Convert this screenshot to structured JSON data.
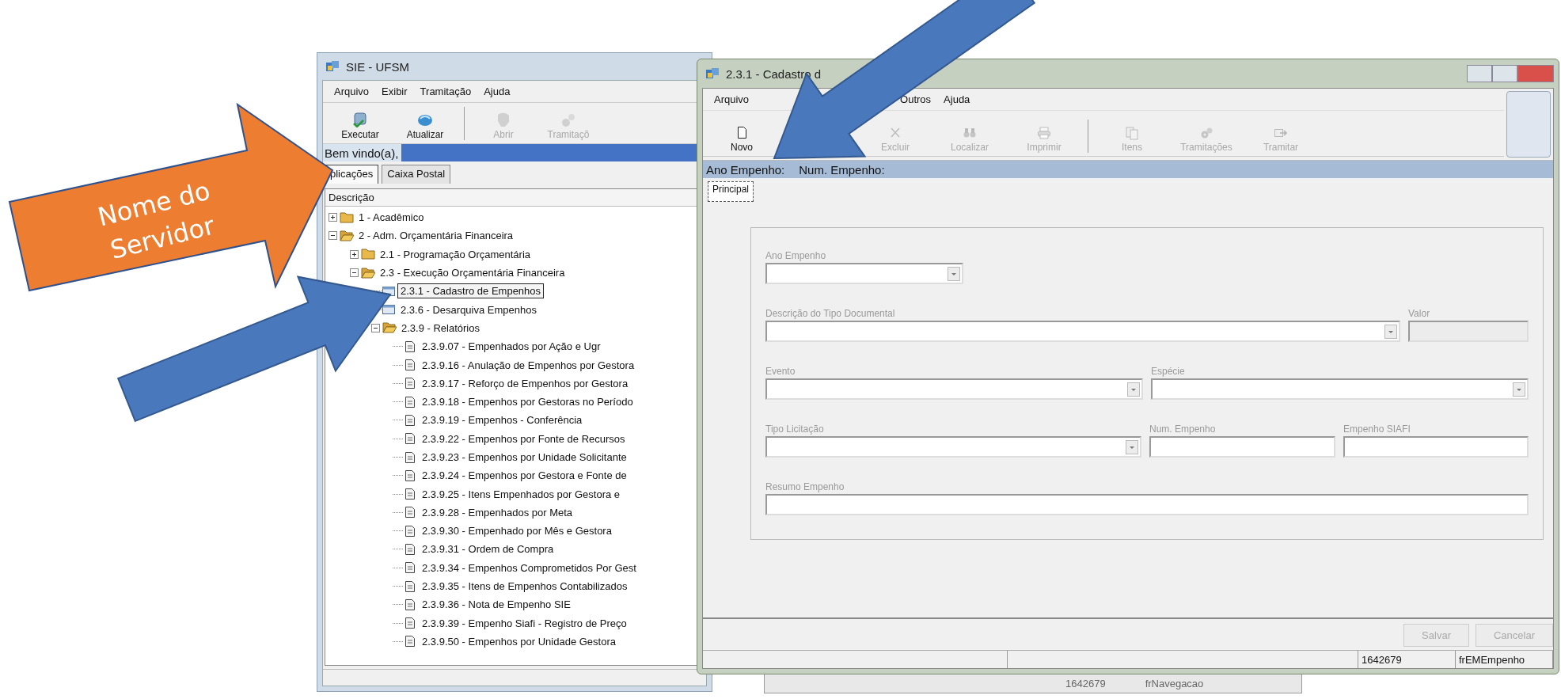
{
  "callout": {
    "lines": [
      "Nome do",
      "Servidor"
    ]
  },
  "main_window": {
    "title": "SIE - UFSM",
    "menu": [
      "Arquivo",
      "Exibir",
      "Tramitação",
      "Ajuda"
    ],
    "toolbar": [
      {
        "label": "Executar",
        "disabled": false
      },
      {
        "label": "Atualizar",
        "disabled": false
      },
      {
        "label": "Abrir",
        "disabled": true
      },
      {
        "label": "Tramitaçõ",
        "disabled": true
      }
    ],
    "welcome": "Bem vindo(a),",
    "tabs": [
      {
        "label": "plicações",
        "selected": true
      },
      {
        "label": "Caixa Postal",
        "selected": false
      }
    ],
    "tree_header": "Descrição",
    "tree": [
      {
        "label": "1 - Acadêmico",
        "kind": "folder",
        "expanded": false,
        "selected": false
      },
      {
        "label": "2 - Adm. Orçamentária Financeira",
        "kind": "folder",
        "expanded": true,
        "selected": false,
        "children": [
          {
            "label": "2.1 - Programação Orçamentária",
            "kind": "folder",
            "expanded": false,
            "selected": false
          },
          {
            "label": "2.3 - Execução Orçamentária Financeira",
            "kind": "folder",
            "expanded": true,
            "selected": false,
            "children": [
              {
                "label": "2.3.1 - Cadastro de Empenhos",
                "kind": "form",
                "selected": true
              },
              {
                "label": "2.3.6 - Desarquiva Empenhos",
                "kind": "form",
                "selected": false
              },
              {
                "label": "2.3.9 - Relatórios",
                "kind": "folder",
                "expanded": true,
                "selected": false,
                "children": [
                  {
                    "label": "2.3.9.07 - Empenhados por Ação e Ugr",
                    "kind": "report",
                    "selected": false
                  },
                  {
                    "label": "2.3.9.16 - Anulação de Empenhos por Gestora",
                    "kind": "report",
                    "selected": false
                  },
                  {
                    "label": "2.3.9.17 - Reforço de Empenhos por Gestora",
                    "kind": "report",
                    "selected": false
                  },
                  {
                    "label": "2.3.9.18 - Empenhos por Gestoras no Período",
                    "kind": "report",
                    "selected": false
                  },
                  {
                    "label": "2.3.9.19 - Empenhos - Conferência",
                    "kind": "report",
                    "selected": false
                  },
                  {
                    "label": "2.3.9.22 - Empenhos por Fonte de Recursos",
                    "kind": "report",
                    "selected": false
                  },
                  {
                    "label": "2.3.9.23 - Empenhos por Unidade Solicitante",
                    "kind": "report",
                    "selected": false
                  },
                  {
                    "label": "2.3.9.24 - Empenhos por Gestora e Fonte de",
                    "kind": "report",
                    "selected": false
                  },
                  {
                    "label": "2.3.9.25 - Itens Empenhados por Gestora e",
                    "kind": "report",
                    "selected": false
                  },
                  {
                    "label": "2.3.9.28 - Empenhados por Meta",
                    "kind": "report",
                    "selected": false
                  },
                  {
                    "label": "2.3.9.30 - Empenhado por Mês e Gestora",
                    "kind": "report",
                    "selected": false
                  },
                  {
                    "label": "2.3.9.31 - Ordem de Compra",
                    "kind": "report",
                    "selected": false
                  },
                  {
                    "label": "2.3.9.34 - Empenhos Comprometidos Por Gest",
                    "kind": "report",
                    "selected": false
                  },
                  {
                    "label": "2.3.9.35 - Itens de Empenhos Contabilizados",
                    "kind": "report",
                    "selected": false
                  },
                  {
                    "label": "2.3.9.36 - Nota de Empenho SIE",
                    "kind": "report",
                    "selected": false
                  },
                  {
                    "label": "2.3.9.39 - Empenho Siafi - Registro de Preço",
                    "kind": "report",
                    "selected": false
                  },
                  {
                    "label": "2.3.9.50 - Empenhos por Unidade Gestora",
                    "kind": "report",
                    "selected": false
                  }
                ]
              }
            ]
          }
        ]
      }
    ]
  },
  "form_window": {
    "title": "2.3.1 - Cadastro d",
    "menu": [
      "Arquivo",
      "Outros",
      "Ajuda"
    ],
    "toolbar": [
      {
        "label": "Novo",
        "disabled": false
      },
      {
        "label": "Excluir",
        "disabled": true
      },
      {
        "label": "Localizar",
        "disabled": true
      },
      {
        "label": "Imprimir",
        "disabled": true
      },
      {
        "label": "Itens",
        "disabled": true
      },
      {
        "label": "Tramitações",
        "disabled": true
      },
      {
        "label": "Tramitar",
        "disabled": true
      }
    ],
    "info": [
      "Ano Empenho:",
      "Num. Empenho:"
    ],
    "tabs": [
      {
        "label": "Principal",
        "selected": true
      }
    ],
    "field_rows": [
      [
        {
          "label": "Ano Empenho",
          "kind": "combo",
          "disabled": false
        }
      ],
      [
        {
          "label": "Descrição do Tipo Documental",
          "kind": "combo",
          "disabled": false
        },
        {
          "label": "Valor",
          "kind": "text",
          "disabled": true
        }
      ],
      [
        {
          "label": "Evento",
          "kind": "combo",
          "disabled": false
        },
        {
          "label": "Espécie",
          "kind": "combo",
          "disabled": false
        }
      ],
      [
        {
          "label": "Tipo Licitação",
          "kind": "combo",
          "disabled": false
        },
        {
          "label": "Num. Empenho",
          "kind": "text",
          "disabled": false
        },
        {
          "label": "Empenho SIAFI",
          "kind": "text",
          "disabled": false
        }
      ],
      [
        {
          "label": "Resumo Empenho",
          "kind": "text",
          "disabled": false
        }
      ]
    ],
    "buttons": [
      {
        "label": "Salvar",
        "disabled": true
      },
      {
        "label": "Cancelar",
        "disabled": true
      }
    ],
    "status": [
      "1642679",
      "frEMEmpenho"
    ]
  },
  "back_status": [
    "1642679",
    "frNavegacao"
  ]
}
